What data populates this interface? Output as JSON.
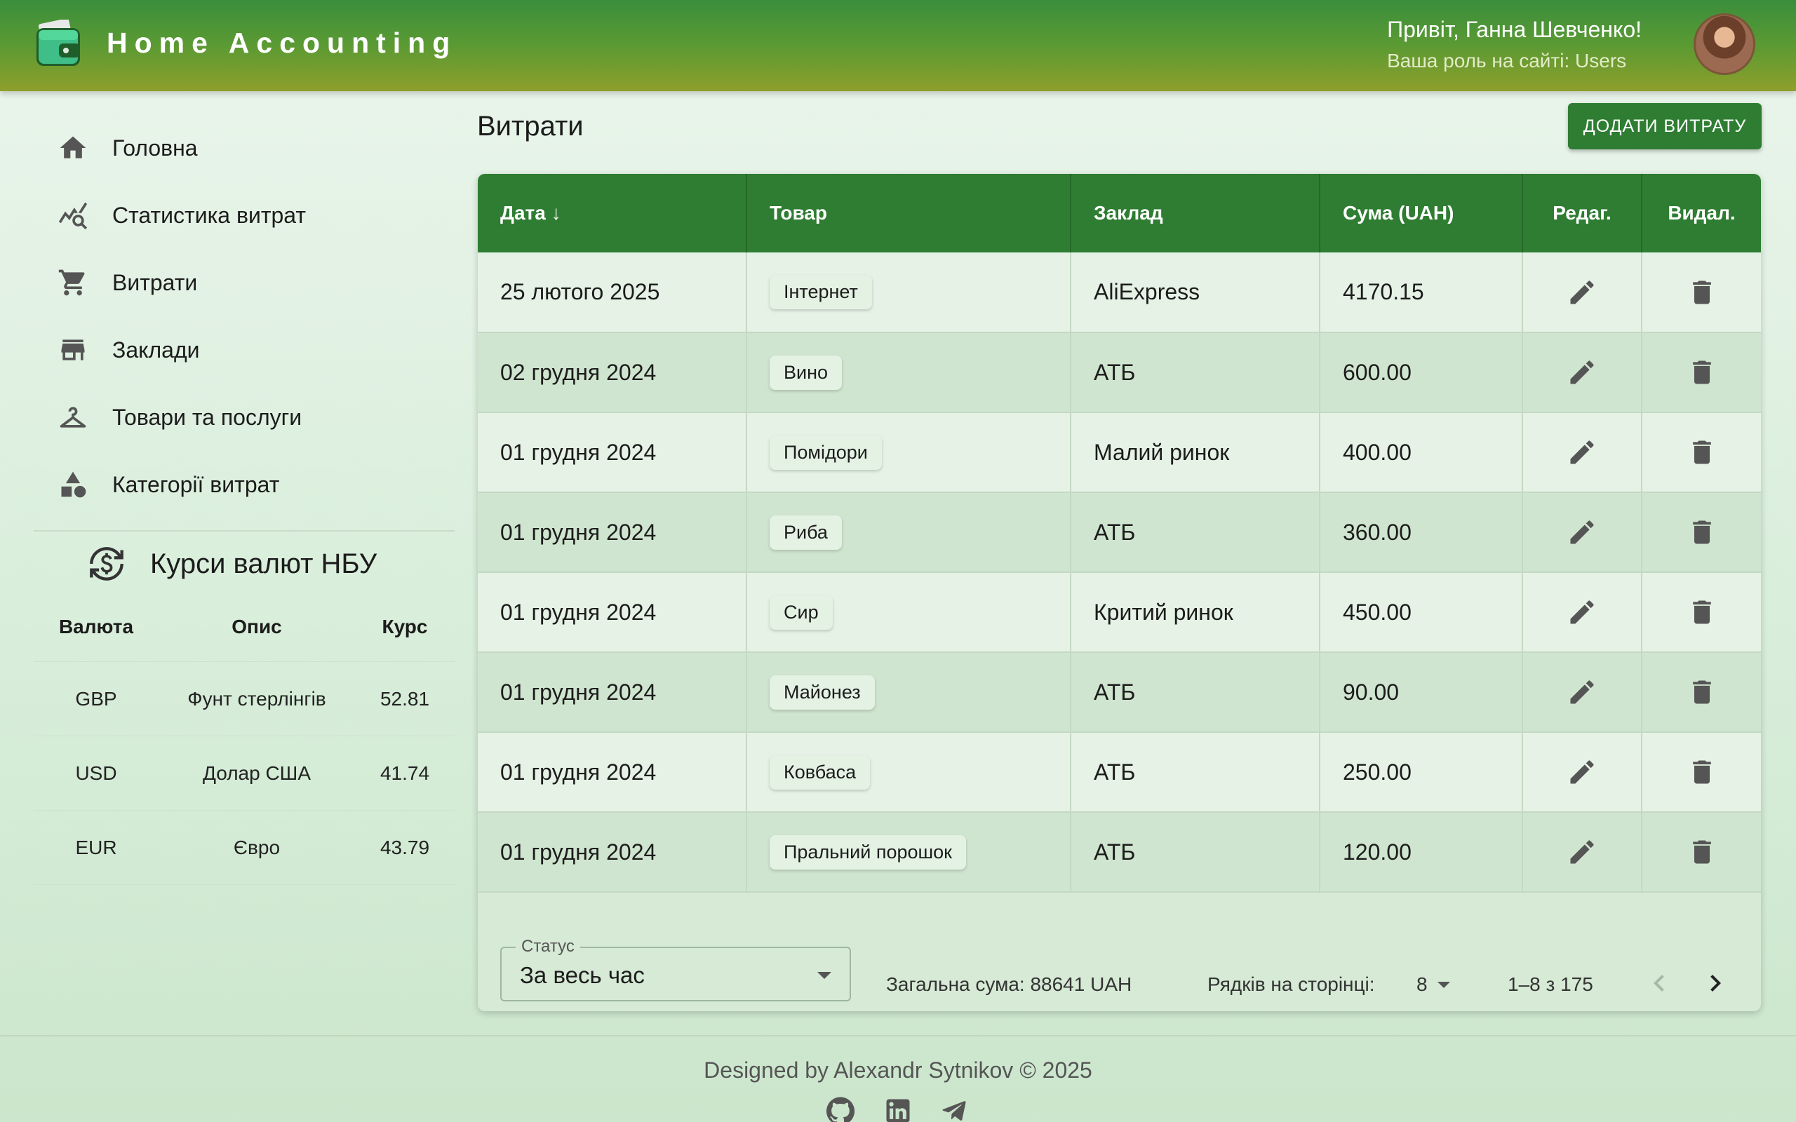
{
  "header": {
    "app_title": "Home Accounting",
    "greeting": "Привіт, Ганна Шевченко!",
    "role": "Ваша роль на сайті: Users"
  },
  "sidebar": {
    "items": [
      {
        "label": "Головна",
        "icon": "home-icon"
      },
      {
        "label": "Статистика витрат",
        "icon": "chart-search-icon"
      },
      {
        "label": "Витрати",
        "icon": "cart-icon"
      },
      {
        "label": "Заклади",
        "icon": "store-icon"
      },
      {
        "label": "Товари та послуги",
        "icon": "hanger-icon"
      },
      {
        "label": "Категорії витрат",
        "icon": "shapes-icon"
      }
    ]
  },
  "rates": {
    "title": "Курси валют НБУ",
    "headers": [
      "Валюта",
      "Опис",
      "Курс"
    ],
    "rows": [
      {
        "code": "GBP",
        "desc": "Фунт стерлінгів",
        "rate": "52.81"
      },
      {
        "code": "USD",
        "desc": "Долар США",
        "rate": "41.74"
      },
      {
        "code": "EUR",
        "desc": "Євро",
        "rate": "43.79"
      }
    ]
  },
  "main": {
    "title": "Витрати",
    "add_button": "ДОДАТИ ВИТРАТУ",
    "columns": [
      "Дата ↓",
      "Товар",
      "Заклад",
      "Сума (UAH)",
      "Редаг.",
      "Видал."
    ],
    "rows": [
      {
        "date": "25 лютого 2025",
        "item": "Інтернет",
        "place": "AliExpress",
        "sum": "4170.15"
      },
      {
        "date": "02 грудня 2024",
        "item": "Вино",
        "place": "АТБ",
        "sum": "600.00"
      },
      {
        "date": "01 грудня 2024",
        "item": "Помідори",
        "place": "Малий ринок",
        "sum": "400.00"
      },
      {
        "date": "01 грудня 2024",
        "item": "Риба",
        "place": "АТБ",
        "sum": "360.00"
      },
      {
        "date": "01 грудня 2024",
        "item": "Сир",
        "place": "Критий ринок",
        "sum": "450.00"
      },
      {
        "date": "01 грудня 2024",
        "item": "Майонез",
        "place": "АТБ",
        "sum": "90.00"
      },
      {
        "date": "01 грудня 2024",
        "item": "Ковбаса",
        "place": "АТБ",
        "sum": "250.00"
      },
      {
        "date": "01 грудня 2024",
        "item": "Пральний порошок",
        "place": "АТБ",
        "sum": "120.00"
      }
    ],
    "status_label": "Статус",
    "status_value": "За весь час",
    "total": "Загальна сума: 88641 UAH",
    "rows_per_page_label": "Рядків на сторінці:",
    "rows_per_page": "8",
    "page_range": "1–8 з 175"
  },
  "footer": {
    "credit": "Designed by Alexandr Sytnikov © 2025",
    "social": [
      "github-icon",
      "linkedin-icon",
      "telegram-icon"
    ]
  },
  "colors": {
    "primary": "#2e7d32",
    "header_gradient_top": "#3a8e3c",
    "header_gradient_bottom": "#8e9f2b",
    "background": "#e3f2e4"
  }
}
